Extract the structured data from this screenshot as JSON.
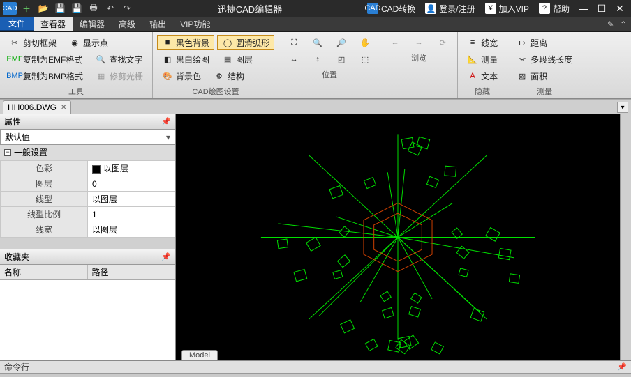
{
  "title": {
    "app_name": "迅捷CAD编辑器"
  },
  "titlebar_links": {
    "cad_convert": "CAD转换",
    "login": "登录/注册",
    "vip": "加入VIP",
    "help": "帮助"
  },
  "menu": {
    "file": "文件",
    "tabs": [
      "查看器",
      "编辑器",
      "高级",
      "输出",
      "VIP功能"
    ],
    "active": 0
  },
  "ribbon": {
    "tools": {
      "label": "工具",
      "cut_frame": "剪切框架",
      "show_dot": "显示点",
      "copy_emf": "复制为EMF格式",
      "find_text": "查找文字",
      "copy_bmp": "复制为BMP格式",
      "retouch": "修剪光栅"
    },
    "cad_settings": {
      "label": "CAD绘图设置",
      "black_bg": "黑色背景",
      "smooth_arc": "圆滑弧形",
      "bw_draw": "黑白绘图",
      "layer": "图层",
      "bg_color": "背景色",
      "structure": "结构"
    },
    "position": {
      "label": "位置"
    },
    "browse": {
      "label": "浏览"
    },
    "hide": {
      "label": "隐藏",
      "lw": "线宽",
      "measure_btn": "测量",
      "text": "文本"
    },
    "measure": {
      "label": "测量",
      "distance": "距离",
      "polyline_len": "多段线长度",
      "area": "面积"
    }
  },
  "doc": {
    "tab": "HH006.DWG",
    "model": "Model"
  },
  "props": {
    "title": "属性",
    "default_combo": "默认值",
    "section": "一般设置",
    "rows": [
      {
        "k": "色彩",
        "v": "以图层",
        "swatch": true
      },
      {
        "k": "图层",
        "v": "0"
      },
      {
        "k": "线型",
        "v": "以图层"
      },
      {
        "k": "线型比例",
        "v": "1"
      },
      {
        "k": "线宽",
        "v": "以图层"
      }
    ]
  },
  "fav": {
    "title": "收藏夹",
    "col_name": "名称",
    "col_path": "路径"
  },
  "cmd": {
    "label": "命令行"
  }
}
